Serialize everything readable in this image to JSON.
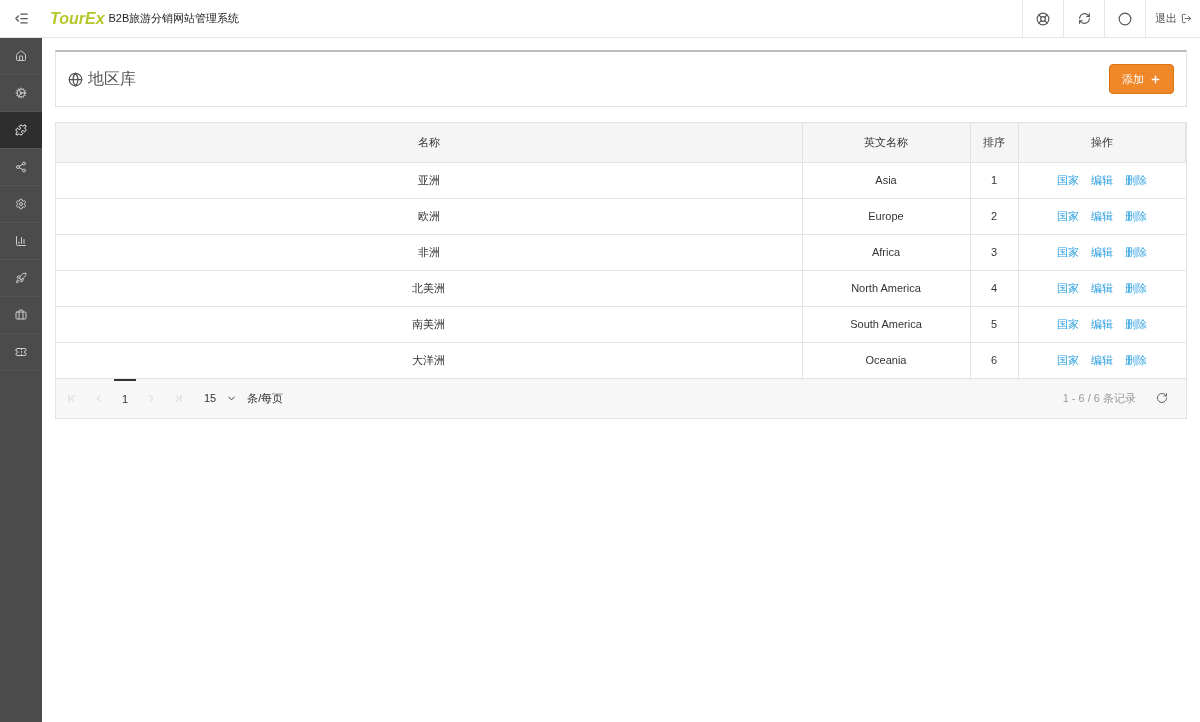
{
  "header": {
    "logo": "TourEx",
    "title": "B2B旅游分销网站管理系统",
    "logout": "退出"
  },
  "sidebar": {
    "items": [
      {
        "kind": "home",
        "selected": false
      },
      {
        "kind": "cogs",
        "selected": false
      },
      {
        "kind": "puzzle",
        "selected": true
      },
      {
        "kind": "share",
        "selected": false
      },
      {
        "kind": "settings",
        "selected": false
      },
      {
        "kind": "chart",
        "selected": false
      },
      {
        "kind": "rocket",
        "selected": false
      },
      {
        "kind": "briefcase",
        "selected": false
      },
      {
        "kind": "ticket",
        "selected": false
      }
    ]
  },
  "page": {
    "title": "地区库",
    "add_button": "添加"
  },
  "table": {
    "columns": [
      "名称",
      "英文名称",
      "排序",
      "操作"
    ],
    "rows": [
      {
        "name": "亚洲",
        "english": "Asia",
        "order": "1",
        "actions": [
          "国家",
          "编辑",
          "删除"
        ]
      },
      {
        "name": "欧洲",
        "english": "Europe",
        "order": "2",
        "actions": [
          "国家",
          "编辑",
          "删除"
        ]
      },
      {
        "name": "非洲",
        "english": "Africa",
        "order": "3",
        "actions": [
          "国家",
          "编辑",
          "删除"
        ]
      },
      {
        "name": "北美洲",
        "english": "North America",
        "order": "4",
        "actions": [
          "国家",
          "编辑",
          "删除"
        ]
      },
      {
        "name": "南美洲",
        "english": "South America",
        "order": "5",
        "actions": [
          "国家",
          "编辑",
          "删除"
        ]
      },
      {
        "name": "大洋洲",
        "english": "Oceania",
        "order": "6",
        "actions": [
          "国家",
          "编辑",
          "删除"
        ]
      }
    ]
  },
  "pager": {
    "pages": [
      {
        "label": "1",
        "selected": true
      }
    ],
    "page_size": "15",
    "page_size_unit": "条/每页",
    "summary": "1 - 6 / 6 条记录"
  }
}
